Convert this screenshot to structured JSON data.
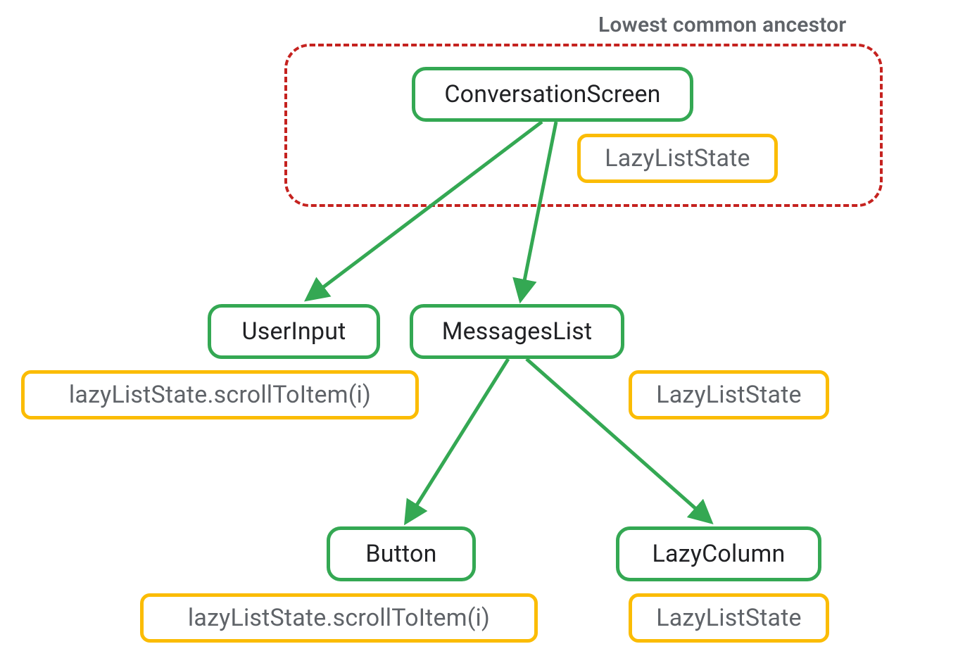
{
  "diagram": {
    "ancestor_label": "Lowest common ancestor",
    "nodes": {
      "conversation_screen": "ConversationScreen",
      "lazy_list_state_top": "LazyListState",
      "user_input": "UserInput",
      "user_input_anno": "lazyListState.scrollToItem(i)",
      "messages_list": "MessagesList",
      "lazy_list_state_mid": "LazyListState",
      "button": "Button",
      "button_anno": "lazyListState.scrollToItem(i)",
      "lazy_column": "LazyColumn",
      "lazy_list_state_bot": "LazyListState"
    },
    "colors": {
      "green": "#34a853",
      "yellow": "#fbbc04",
      "dashed": "#c5221f",
      "text_primary": "#202124",
      "text_secondary": "#5f6368"
    }
  }
}
